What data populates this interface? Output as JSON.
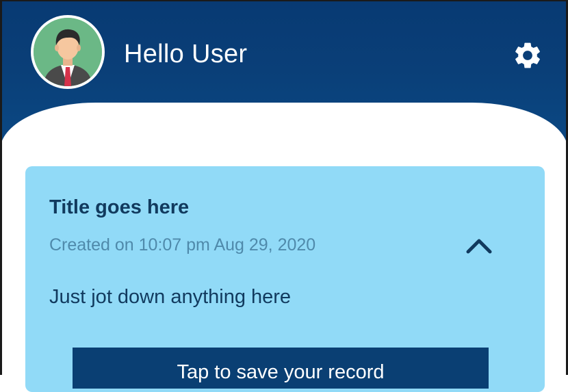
{
  "header": {
    "greeting": "Hello User",
    "avatar_icon": "user-avatar",
    "settings_icon": "gear-icon"
  },
  "note_card": {
    "title": "Title goes here",
    "created": "Created on 10:07 pm Aug 29, 2020",
    "body": "Just jot down anything here",
    "collapse_icon": "chevron-up-icon",
    "button_label": "Tap to save your record"
  },
  "colors": {
    "header_bg": "#083a73",
    "card_bg": "#91daf7",
    "title_text": "#113a5e",
    "date_text": "#4f8aab",
    "button_bg": "#0a3f73"
  }
}
